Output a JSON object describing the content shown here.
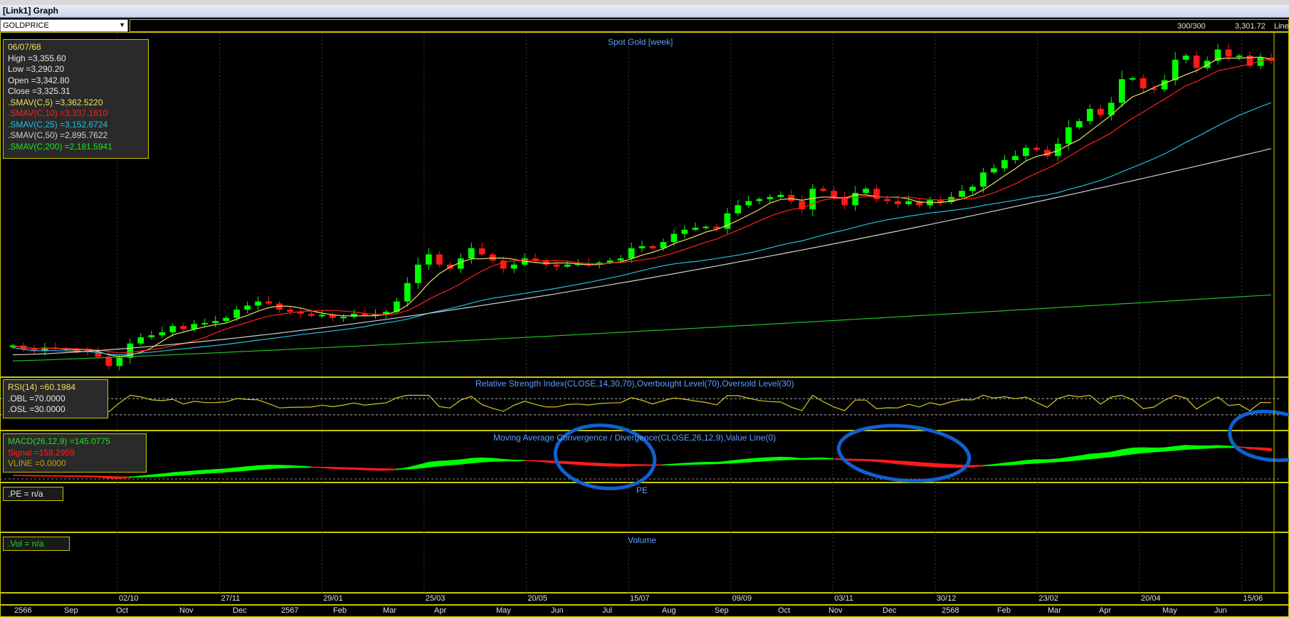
{
  "window": {
    "title": "[Link1] Graph"
  },
  "toolbar": {
    "symbol": "GOLDPRICE",
    "count": "300/300",
    "price": "3,301.72",
    "chart_style": "Line"
  },
  "price_panel": {
    "title": "Spot Gold [week]",
    "info": {
      "date": "06/07/68",
      "high": "High  =3,355.60",
      "low": "Low  =3,290.20",
      "open": "Open  =3,342.80",
      "close": "Close  =3,325.31",
      "sma5": ".SMAV(C,5)   =3,362.5220",
      "sma10": ".SMAV(C,10)   =3,337.1610",
      "sma25": ".SMAV(C,25)   =3,152.6724",
      "sma50": ".SMAV(C,50)   =2,895.7622",
      "sma200": ".SMAV(C,200)   =2,181.5941"
    }
  },
  "rsi_panel": {
    "title": "Relative Strength Index(CLOSE,14,30,70),Overbought Level(70),Oversold Level(30)",
    "rsi": "RSI(14)   =60.1984",
    "obl": ".OBL   =70.0000",
    "osl": ".OSL   =30.0000"
  },
  "macd_panel": {
    "title": "Moving Average Convergence / Divergence(CLOSE,26,12,9),Value Line(0)",
    "macd": "MACD(26,12,9)   =145.0775",
    "signal": "Signal   =158.2959",
    "vline": "VLINE   =0.0000"
  },
  "pe_panel": {
    "title": "PE",
    "value": ".PE   = n/a"
  },
  "volume_panel": {
    "title": "Volume",
    "value": ".Vol   = n/a"
  },
  "x_axis": {
    "dates": [
      "02/10",
      "27/11",
      "29/01",
      "25/03",
      "20/05",
      "15/07",
      "09/09",
      "03/11",
      "30/12",
      "23/02",
      "20/04",
      "15/06"
    ],
    "months": [
      "2566",
      "Sep",
      "Oct",
      "Nov",
      "Dec",
      "2567",
      "Feb",
      "Mar",
      "Apr",
      "May",
      "Jun",
      "Jul",
      "Aug",
      "Sep",
      "Oct",
      "Nov",
      "Dec",
      "2568",
      "Feb",
      "Mar",
      "Apr",
      "May",
      "Jun"
    ]
  },
  "colors": {
    "up_candle": "#00ff00",
    "down_candle": "#ff1a1a",
    "sma5": "#f0e060",
    "sma10": "#ff2020",
    "sma25": "#20c0e0",
    "sma50": "#d0d0d0",
    "sma200": "#20c020",
    "rsi_line": "#d8c820",
    "macd_pos": "#00ff00",
    "macd_neg": "#ff1a1a",
    "panel_border": "#c8c800",
    "title": "#5aa0ff",
    "annotation": "#1060d0"
  },
  "chart_data": {
    "type": "candlestick",
    "symbol": "GOLDPRICE",
    "title": "Spot Gold [week]",
    "ylim": [
      1850,
      3420
    ],
    "weekly_close": [
      1935,
      1918,
      1908,
      1925,
      1920,
      1915,
      1912,
      1905,
      1880,
      1835,
      1875,
      1945,
      1975,
      1985,
      2000,
      2030,
      2015,
      2040,
      2045,
      2055,
      2070,
      2110,
      2130,
      2150,
      2140,
      2110,
      2100,
      2090,
      2080,
      2085,
      2070,
      2075,
      2090,
      2080,
      2088,
      2100,
      2150,
      2240,
      2330,
      2380,
      2330,
      2310,
      2360,
      2410,
      2380,
      2350,
      2310,
      2330,
      2360,
      2350,
      2330,
      2320,
      2330,
      2335,
      2330,
      2340,
      2350,
      2360,
      2410,
      2420,
      2410,
      2440,
      2480,
      2500,
      2510,
      2515,
      2505,
      2580,
      2620,
      2640,
      2650,
      2660,
      2670,
      2640,
      2600,
      2700,
      2690,
      2660,
      2620,
      2680,
      2700,
      2650,
      2640,
      2625,
      2640,
      2620,
      2645,
      2635,
      2660,
      2690,
      2710,
      2780,
      2800,
      2840,
      2860,
      2900,
      2890,
      2860,
      2920,
      3000,
      3030,
      3090,
      3060,
      3120,
      3235,
      3240,
      3190,
      3185,
      3230,
      3330,
      3350,
      3290,
      3325,
      3380,
      3345,
      3350,
      3300,
      3340,
      3325
    ],
    "sma": [
      {
        "name": "SMAV(C,5)",
        "last": 3362.522
      },
      {
        "name": "SMAV(C,10)",
        "last": 3337.161
      },
      {
        "name": "SMAV(C,25)",
        "last": 3152.6724
      },
      {
        "name": "SMAV(C,50)",
        "last": 2895.7622
      },
      {
        "name": "SMAV(C,200)",
        "last": 2181.5941
      }
    ],
    "last_bar": {
      "date": "06/07/68",
      "high": 3355.6,
      "low": 3290.2,
      "open": 3342.8,
      "close": 3325.31
    },
    "rsi": {
      "period": 14,
      "last": 60.1984,
      "overbought": 70,
      "oversold": 30
    },
    "macd": {
      "params": "26,12,9",
      "macd": 145.0775,
      "signal": 158.2959,
      "value_line": 0
    }
  }
}
